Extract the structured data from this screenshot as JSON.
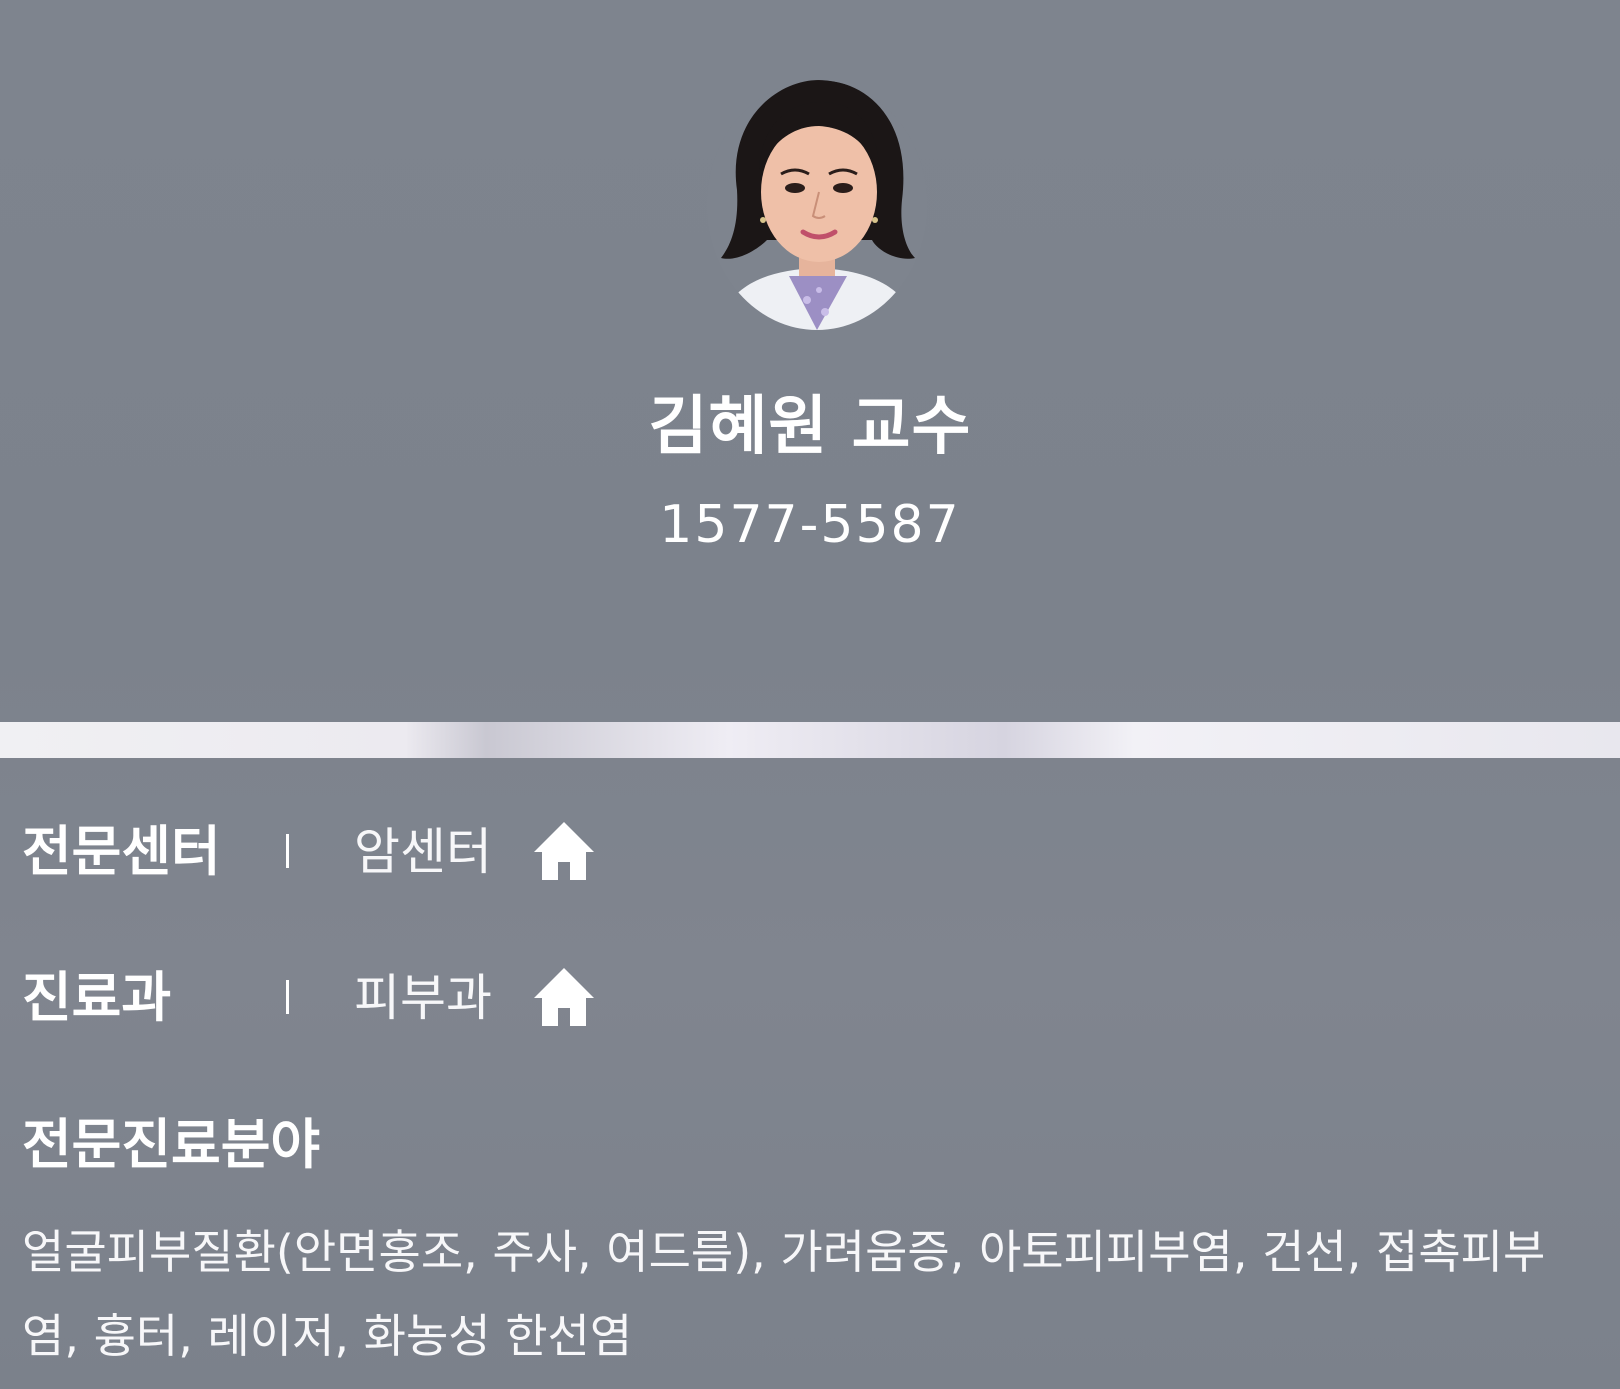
{
  "doctor": {
    "name": "김혜원 교수",
    "phone": "1577-5587"
  },
  "details": {
    "center": {
      "label": "전문센터",
      "value": "암센터",
      "icon": "home-icon"
    },
    "department": {
      "label": "진료과",
      "value": "피부과",
      "icon": "home-icon"
    }
  },
  "specialty": {
    "title": "전문진료분야",
    "text": "얼굴피부질환(안면홍조, 주사, 여드름), 가려움증, 아토피피부염, 건선, 접촉피부염, 흉터, 레이저, 화농성 한선염"
  },
  "colors": {
    "background": "#7e848e",
    "text": "#ffffff",
    "divider": "#eceaf0"
  }
}
